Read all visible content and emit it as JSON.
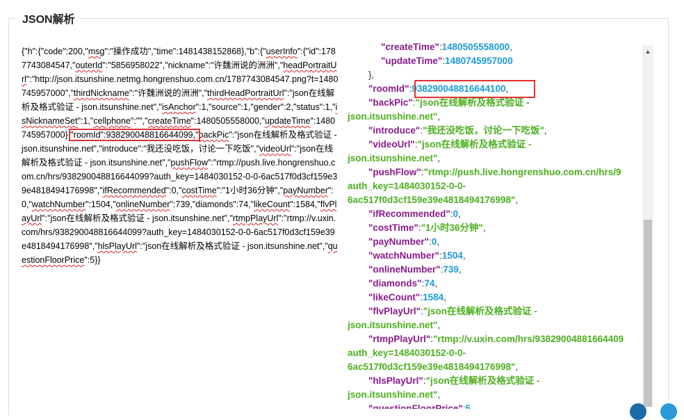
{
  "section_title": "JSON解析",
  "raw_segments": [
    {
      "t": "{\"h\":{\"code\":200,\""
    },
    {
      "t": "msg",
      "k": true
    },
    {
      "t": "\":\"操作成功\",\"time\":1481438152868},\"b\":{\""
    },
    {
      "t": "userInfo",
      "k": true
    },
    {
      "t": "\":{\"id\":1787743084547,\""
    },
    {
      "t": "outerId",
      "k": true
    },
    {
      "t": "\":\"5856958022\",\"nickname\":\"许魏洲说的洲洲\",\""
    },
    {
      "t": "headPortraitUrl",
      "k": true
    },
    {
      "t": "\":\"http://json.itsunshine.netmg.hongrenshuo.com.cn/1787743084547.png?t=1480745957000\",\""
    },
    {
      "t": "thirdNickname",
      "k": true
    },
    {
      "t": "\":\"许魏洲说的洲洲\",\""
    },
    {
      "t": "thirdHeadPortraitUrl",
      "k": true
    },
    {
      "t": "\":\"json在线解析及格式验证 - json.itsunshine.net\",\""
    },
    {
      "t": "isAnchor",
      "k": true
    },
    {
      "t": "\":1,\"source\":1,\"gender\":2,\"status\":1,\""
    },
    {
      "t": "isNicknameSet",
      "k": true
    },
    {
      "t": "\":1,\""
    },
    {
      "t": "cellphone",
      "k": true
    },
    {
      "t": "\":\"\",\""
    },
    {
      "t": "createTime",
      "k": true
    },
    {
      "t": "\":1480505558000,\""
    },
    {
      "t": "updateTime",
      "k": true
    },
    {
      "t": "\":1480745957000},"
    },
    {
      "t": "\"roomId\":938290048816644099,\"",
      "hl": true
    },
    {
      "t": "backPic",
      "k": true
    },
    {
      "t": "\":\"json在线解析及格式验证 - json.itsunshine.net\",\"introduce\":\"我还没吃饭，讨论一下吃饭\",\""
    },
    {
      "t": "videoUrl",
      "k": true
    },
    {
      "t": "\":\"json在线解析及格式验证 - json.itsunshine.net\",\""
    },
    {
      "t": "pushFlow",
      "k": true
    },
    {
      "t": "\":\"rtmp://push.live.hongrenshuo.com.cn/hrs/938290048816644099?auth_key=1484030152-0-0-6ac517f0d3cf159e39e4818494176998\",\""
    },
    {
      "t": "ifRecommended",
      "k": true
    },
    {
      "t": "\":0,\""
    },
    {
      "t": "costTime",
      "k": true
    },
    {
      "t": "\":\"1小时36分钟\",\""
    },
    {
      "t": "payNumber",
      "k": true
    },
    {
      "t": "\":0,\""
    },
    {
      "t": "watchNumber",
      "k": true
    },
    {
      "t": "\":1504,\""
    },
    {
      "t": "onlineNumber",
      "k": true
    },
    {
      "t": "\":739,\"diamonds\":74,\""
    },
    {
      "t": "likeCount",
      "k": true
    },
    {
      "t": "\":1584,\""
    },
    {
      "t": "flvPlayUrl",
      "k": true
    },
    {
      "t": "\":\"json在线解析及格式验证 - json.itsunshine.net\",\""
    },
    {
      "t": "rtmpPlayUrl",
      "k": true
    },
    {
      "t": "\":\"rtmp://v.uxin.com/hrs/938290048816644099?auth_key=1484030152-0-0-6ac517f0d3cf159e39e4818494176998\",\""
    },
    {
      "t": "hlsPlayUrl",
      "k": true
    },
    {
      "t": "\":\"json在线解析及格式验证 - json.itsunshine.net\",\""
    },
    {
      "t": "questionFloorPrice",
      "k": true
    },
    {
      "t": "\":5}}"
    }
  ],
  "tree_lines": [
    {
      "ind": 48,
      "p": [
        {
          "c": "k",
          "t": "\"createTime\""
        },
        {
          "c": "p",
          "t": ":"
        },
        {
          "c": "n",
          "t": "1480505558000"
        },
        {
          "c": "p",
          "t": ","
        }
      ]
    },
    {
      "ind": 48,
      "p": [
        {
          "c": "k",
          "t": "\"updateTime\""
        },
        {
          "c": "p",
          "t": ":"
        },
        {
          "c": "n",
          "t": "1480745957000"
        }
      ]
    },
    {
      "ind": 30,
      "p": [
        {
          "c": "p",
          "t": "},"
        }
      ]
    },
    {
      "ind": 30,
      "p": [
        {
          "c": "k",
          "t": "\"roomId\""
        },
        {
          "c": "p",
          "t": ":"
        },
        {
          "c": "n",
          "t": "938290048816644100"
        },
        {
          "c": "p",
          "t": ","
        }
      ]
    },
    {
      "ind": 30,
      "p": [
        {
          "c": "k",
          "t": "\"backPic\""
        },
        {
          "c": "p",
          "t": ":"
        },
        {
          "c": "s",
          "t": "\"json在线解析及格式验证 -"
        }
      ]
    },
    {
      "ind": 0,
      "p": [
        {
          "c": "s",
          "t": "json.itsunshine.net\""
        },
        {
          "c": "p",
          "t": ","
        }
      ]
    },
    {
      "ind": 30,
      "p": [
        {
          "c": "k",
          "t": "\"introduce\""
        },
        {
          "c": "p",
          "t": ":"
        },
        {
          "c": "s",
          "t": "\"我还没吃饭，讨论一下吃饭\""
        },
        {
          "c": "p",
          "t": ","
        }
      ]
    },
    {
      "ind": 30,
      "p": [
        {
          "c": "k",
          "t": "\"videoUrl\""
        },
        {
          "c": "p",
          "t": ":"
        },
        {
          "c": "s",
          "t": "\"json在线解析及格式验证 -"
        }
      ]
    },
    {
      "ind": 0,
      "p": [
        {
          "c": "s",
          "t": "json.itsunshine.net\""
        },
        {
          "c": "p",
          "t": ","
        }
      ]
    },
    {
      "ind": 30,
      "p": [
        {
          "c": "k",
          "t": "\"pushFlow\""
        },
        {
          "c": "p",
          "t": ":"
        },
        {
          "c": "s",
          "t": "\"rtmp://push.live.hongrenshuo.com.cn/hrs/9"
        }
      ]
    },
    {
      "ind": 0,
      "p": [
        {
          "c": "s",
          "t": "auth_key=1484030152-0-0-"
        }
      ]
    },
    {
      "ind": 0,
      "p": [
        {
          "c": "s",
          "t": "6ac517f0d3cf159e39e4818494176998\""
        },
        {
          "c": "p",
          "t": ","
        }
      ]
    },
    {
      "ind": 30,
      "p": [
        {
          "c": "k",
          "t": "\"ifRecommended\""
        },
        {
          "c": "p",
          "t": ":"
        },
        {
          "c": "n",
          "t": "0"
        },
        {
          "c": "p",
          "t": ","
        }
      ]
    },
    {
      "ind": 30,
      "p": [
        {
          "c": "k",
          "t": "\"costTime\""
        },
        {
          "c": "p",
          "t": ":"
        },
        {
          "c": "s",
          "t": "\"1小时36分钟\""
        },
        {
          "c": "p",
          "t": ","
        }
      ]
    },
    {
      "ind": 30,
      "p": [
        {
          "c": "k",
          "t": "\"payNumber\""
        },
        {
          "c": "p",
          "t": ":"
        },
        {
          "c": "n",
          "t": "0"
        },
        {
          "c": "p",
          "t": ","
        }
      ]
    },
    {
      "ind": 30,
      "p": [
        {
          "c": "k",
          "t": "\"watchNumber\""
        },
        {
          "c": "p",
          "t": ":"
        },
        {
          "c": "n",
          "t": "1504"
        },
        {
          "c": "p",
          "t": ","
        }
      ]
    },
    {
      "ind": 30,
      "p": [
        {
          "c": "k",
          "t": "\"onlineNumber\""
        },
        {
          "c": "p",
          "t": ":"
        },
        {
          "c": "n",
          "t": "739"
        },
        {
          "c": "p",
          "t": ","
        }
      ]
    },
    {
      "ind": 30,
      "p": [
        {
          "c": "k",
          "t": "\"diamonds\""
        },
        {
          "c": "p",
          "t": ":"
        },
        {
          "c": "n",
          "t": "74"
        },
        {
          "c": "p",
          "t": ","
        }
      ]
    },
    {
      "ind": 30,
      "p": [
        {
          "c": "k",
          "t": "\"likeCount\""
        },
        {
          "c": "p",
          "t": ":"
        },
        {
          "c": "n",
          "t": "1584"
        },
        {
          "c": "p",
          "t": ","
        }
      ]
    },
    {
      "ind": 30,
      "p": [
        {
          "c": "k",
          "t": "\"flvPlayUrl\""
        },
        {
          "c": "p",
          "t": ":"
        },
        {
          "c": "s",
          "t": "\"json在线解析及格式验证 -"
        }
      ]
    },
    {
      "ind": 0,
      "p": [
        {
          "c": "s",
          "t": "json.itsunshine.net\""
        },
        {
          "c": "p",
          "t": ","
        }
      ]
    },
    {
      "ind": 30,
      "p": [
        {
          "c": "k",
          "t": "\"rtmpPlayUrl\""
        },
        {
          "c": "p",
          "t": ":"
        },
        {
          "c": "s",
          "t": "\"rtmp://v.uxin.com/hrs/93829004881664409"
        }
      ]
    },
    {
      "ind": 0,
      "p": [
        {
          "c": "s",
          "t": "auth_key=1484030152-0-0-"
        }
      ]
    },
    {
      "ind": 0,
      "p": [
        {
          "c": "s",
          "t": "6ac517f0d3cf159e39e4818494176998\""
        },
        {
          "c": "p",
          "t": ","
        }
      ]
    },
    {
      "ind": 30,
      "p": [
        {
          "c": "k",
          "t": "\"hlsPlayUrl\""
        },
        {
          "c": "p",
          "t": ":"
        },
        {
          "c": "s",
          "t": "\"json在线解析及格式验证 -"
        }
      ]
    },
    {
      "ind": 0,
      "p": [
        {
          "c": "s",
          "t": "json.itsunshine.net\""
        },
        {
          "c": "p",
          "t": ","
        }
      ]
    },
    {
      "ind": 30,
      "p": [
        {
          "c": "k",
          "t": "\"questionFloorPrice\""
        },
        {
          "c": "p",
          "t": ":"
        },
        {
          "c": "n",
          "t": "5"
        }
      ]
    }
  ],
  "colors": {
    "key": "#8a1a8a",
    "string": "#4caf1f",
    "number": "#1a9ad6",
    "highlight": "#e03232",
    "fab_primary": "#1e6aa8",
    "fab_secondary": "#2a9ad8"
  },
  "scrollbar": {
    "up_glyph": "▲"
  }
}
